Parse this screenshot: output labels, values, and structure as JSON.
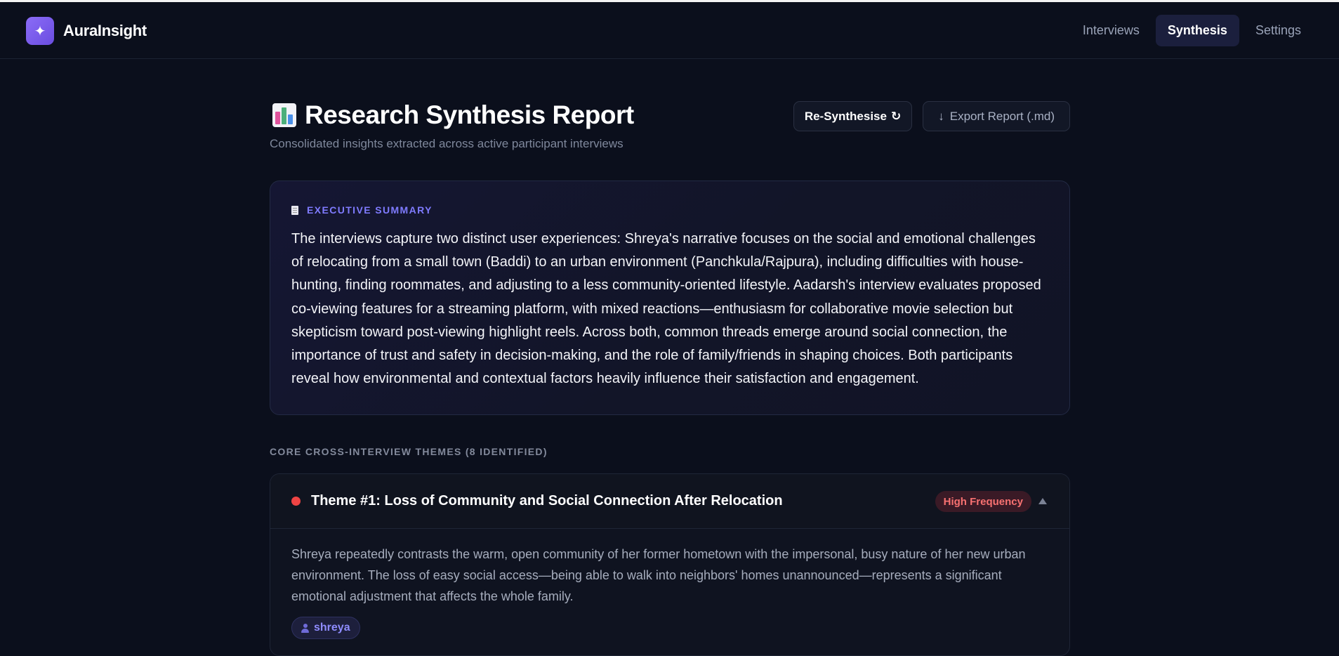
{
  "app": {
    "name": "AuraInsight",
    "logo_glyph": "✦"
  },
  "nav": {
    "items": [
      {
        "label": "Interviews",
        "active": false
      },
      {
        "label": "Synthesis",
        "active": true
      },
      {
        "label": "Settings",
        "active": false
      }
    ]
  },
  "page": {
    "title": "Research Synthesis Report",
    "title_icon": "bar-chart-emoji",
    "subtitle": "Consolidated insights extracted across active participant interviews"
  },
  "actions": {
    "resynthesise_label": "Re-Synthesise",
    "resynthesise_icon": "↻",
    "export_label": "Export Report (.md)",
    "export_icon": "↓"
  },
  "summary": {
    "label": "EXECUTIVE SUMMARY",
    "text": "The interviews capture two distinct user experiences: Shreya's narrative focuses on the social and emotional challenges of relocating from a small town (Baddi) to an urban environment (Panchkula/Rajpura), including difficulties with house-hunting, finding roommates, and adjusting to a less community-oriented lifestyle. Aadarsh's interview evaluates proposed co-viewing features for a streaming platform, with mixed reactions—enthusiasm for collaborative movie selection but skepticism toward post-viewing highlight reels. Across both, common threads emerge around social connection, the importance of trust and safety in decision-making, and the role of family/friends in shaping choices. Both participants reveal how environmental and contextual factors heavily influence their satisfaction and engagement."
  },
  "themes": {
    "heading": "CORE CROSS-INTERVIEW THEMES (8 IDENTIFIED)",
    "items": [
      {
        "title": "Theme #1: Loss of Community and Social Connection After Relocation",
        "frequency": "High Frequency",
        "dot_color": "#ef4444",
        "description": "Shreya repeatedly contrasts the warm, open community of her former hometown with the impersonal, busy nature of her new urban environment. The loss of easy social access—being able to walk into neighbors' homes unannounced—represents a significant emotional adjustment that affects the whole family.",
        "participants": [
          "shreya"
        ]
      }
    ]
  },
  "colors": {
    "background": "#0b0f1c",
    "accent": "#7f7bff",
    "high_frequency": "#f87171"
  }
}
